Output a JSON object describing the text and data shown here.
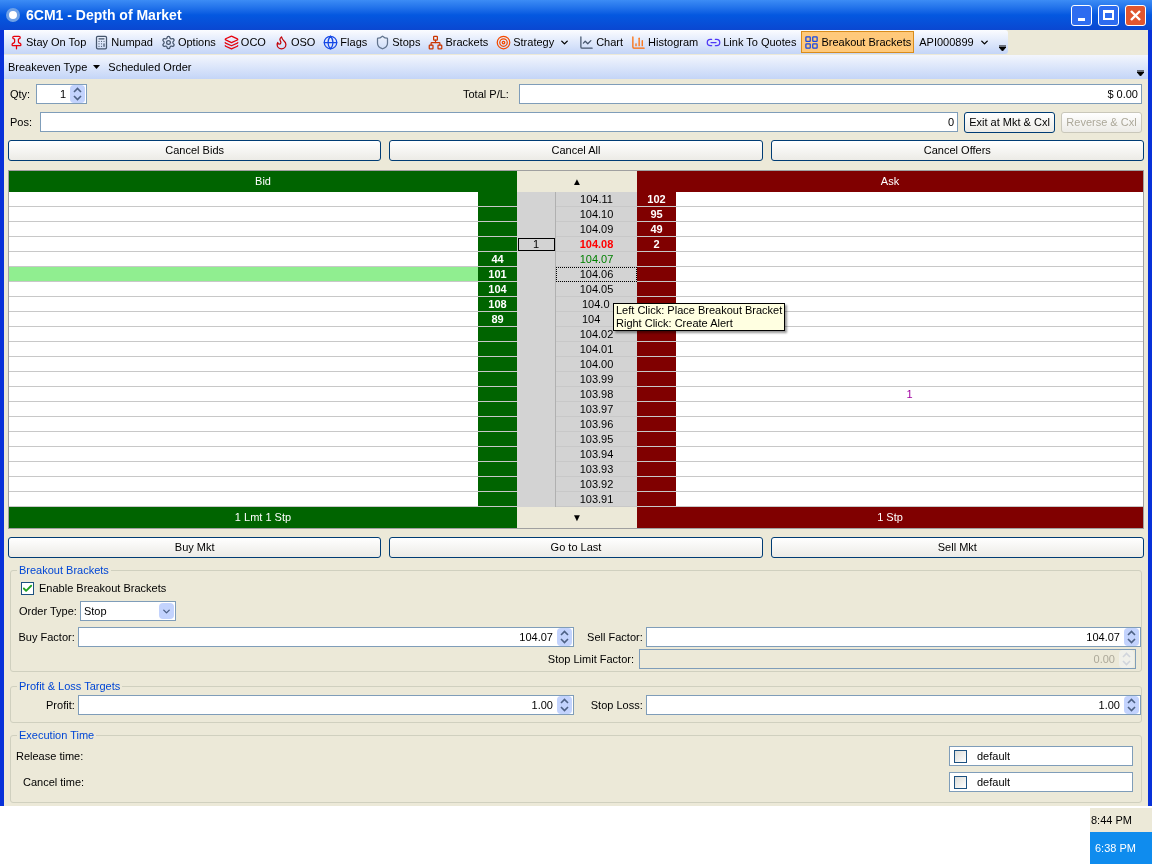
{
  "window": {
    "title": "6CM1 - Depth of Market"
  },
  "toolbar": [
    {
      "label": "Stay On Top",
      "kind": "button",
      "selected": false
    },
    {
      "label": "Numpad",
      "kind": "button",
      "selected": false
    },
    {
      "label": "Options",
      "kind": "button",
      "selected": false
    },
    {
      "label": "OCO",
      "kind": "button",
      "selected": false
    },
    {
      "label": "OSO",
      "kind": "button",
      "selected": false
    },
    {
      "label": "Flags",
      "kind": "button",
      "selected": false
    },
    {
      "label": "Stops",
      "kind": "button",
      "selected": false
    },
    {
      "label": "Brackets",
      "kind": "button",
      "selected": false
    },
    {
      "label": "Strategy",
      "kind": "dropdown",
      "selected": false
    },
    {
      "label": "Chart",
      "kind": "button",
      "selected": false
    },
    {
      "label": "Histogram",
      "kind": "button",
      "selected": false
    },
    {
      "label": "Link To Quotes",
      "kind": "button",
      "selected": false
    },
    {
      "label": "Breakout Brackets",
      "kind": "button",
      "selected": true
    },
    {
      "label": "API000899",
      "kind": "dropdown",
      "selected": false
    }
  ],
  "toolbar2": [
    {
      "label": "Breakeven Type",
      "kind": "dropdown"
    },
    {
      "label": "Scheduled Order",
      "kind": "button"
    }
  ],
  "qty": {
    "label": "Qty:",
    "value": "1"
  },
  "total_pl": {
    "label": "Total P/L:",
    "value": "$ 0.00"
  },
  "pos": {
    "label": "Pos:",
    "value": "0"
  },
  "pos_buttons": [
    {
      "label": "Exit at Mkt & Cxl",
      "disabled": false
    },
    {
      "label": "Reverse & Cxl",
      "disabled": true
    }
  ],
  "cancel_buttons": [
    "Cancel Bids",
    "Cancel All",
    "Cancel Offers"
  ],
  "ladder": {
    "header": {
      "bid": "Bid",
      "up": "▲",
      "ask": "Ask"
    },
    "rows": [
      {
        "price": "104.11",
        "kind": "normal",
        "bid": "",
        "order": "",
        "ask": "102",
        "ask_note": "",
        "selected": false,
        "focused": false
      },
      {
        "price": "104.10",
        "kind": "normal",
        "bid": "",
        "order": "",
        "ask": "95",
        "ask_note": "",
        "selected": false,
        "focused": false
      },
      {
        "price": "104.09",
        "kind": "normal",
        "bid": "",
        "order": "",
        "ask": "49",
        "ask_note": "",
        "selected": false,
        "focused": false
      },
      {
        "price": "104.08",
        "kind": "last",
        "bid": "",
        "order": "1",
        "ask": "2",
        "ask_note": "",
        "selected": false,
        "focused": false
      },
      {
        "price": "104.07",
        "kind": "up",
        "bid": "44",
        "order": "",
        "ask": "",
        "ask_note": "",
        "selected": false,
        "focused": false
      },
      {
        "price": "104.06",
        "kind": "normal",
        "bid": "101",
        "order": "",
        "ask": "",
        "ask_note": "",
        "selected": true,
        "focused": true
      },
      {
        "price": "104.05",
        "kind": "normal",
        "bid": "104",
        "order": "",
        "ask": "",
        "ask_note": "",
        "selected": false,
        "focused": false
      },
      {
        "price": "104.0",
        "kind": "normal",
        "bid": "108",
        "order": "",
        "ask": "",
        "ask_note": "",
        "selected": false,
        "focused": false
      },
      {
        "price": "104",
        "kind": "normal",
        "bid": "89",
        "order": "",
        "ask": "",
        "ask_note": "",
        "selected": false,
        "focused": false
      },
      {
        "price": "104.02",
        "kind": "normal",
        "bid": "",
        "order": "",
        "ask": "",
        "ask_note": "",
        "selected": false,
        "focused": false
      },
      {
        "price": "104.01",
        "kind": "normal",
        "bid": "",
        "order": "",
        "ask": "",
        "ask_note": "",
        "selected": false,
        "focused": false
      },
      {
        "price": "104.00",
        "kind": "normal",
        "bid": "",
        "order": "",
        "ask": "",
        "ask_note": "",
        "selected": false,
        "focused": false
      },
      {
        "price": "103.99",
        "kind": "normal",
        "bid": "",
        "order": "",
        "ask": "",
        "ask_note": "",
        "selected": false,
        "focused": false
      },
      {
        "price": "103.98",
        "kind": "normal",
        "bid": "",
        "order": "",
        "ask": "",
        "ask_note": "1",
        "selected": false,
        "focused": false
      },
      {
        "price": "103.97",
        "kind": "normal",
        "bid": "",
        "order": "",
        "ask": "",
        "ask_note": "",
        "selected": false,
        "focused": false
      },
      {
        "price": "103.96",
        "kind": "normal",
        "bid": "",
        "order": "",
        "ask": "",
        "ask_note": "",
        "selected": false,
        "focused": false
      },
      {
        "price": "103.95",
        "kind": "normal",
        "bid": "",
        "order": "",
        "ask": "",
        "ask_note": "",
        "selected": false,
        "focused": false
      },
      {
        "price": "103.94",
        "kind": "normal",
        "bid": "",
        "order": "",
        "ask": "",
        "ask_note": "",
        "selected": false,
        "focused": false
      },
      {
        "price": "103.93",
        "kind": "normal",
        "bid": "",
        "order": "",
        "ask": "",
        "ask_note": "",
        "selected": false,
        "focused": false
      },
      {
        "price": "103.92",
        "kind": "normal",
        "bid": "",
        "order": "",
        "ask": "",
        "ask_note": "",
        "selected": false,
        "focused": false
      },
      {
        "price": "103.91",
        "kind": "normal",
        "bid": "",
        "order": "",
        "ask": "",
        "ask_note": "",
        "selected": false,
        "focused": false
      }
    ],
    "footer": {
      "bid": "1 Lmt 1 Stp",
      "down": "▼",
      "ask": "1 Stp"
    },
    "tooltip": [
      "Left Click: Place Breakout Bracket",
      "Right Click: Create Alert"
    ]
  },
  "action_buttons": [
    "Buy Mkt",
    "Go to Last",
    "Sell Mkt"
  ],
  "breakout": {
    "title": "Breakout Brackets",
    "enable": {
      "label": "Enable Breakout Brackets",
      "checked": true
    },
    "order_type": {
      "label": "Order Type:",
      "value": "Stop"
    },
    "buy_factor": {
      "label": "Buy Factor:",
      "value": "104.07"
    },
    "sell_factor": {
      "label": "Sell Factor:",
      "value": "104.07"
    },
    "stop_limit": {
      "label": "Stop Limit Factor:",
      "value": "0.00",
      "disabled": true
    }
  },
  "pl_targets": {
    "title": "Profit & Loss Targets",
    "profit": {
      "label": "Profit:",
      "value": "1.00"
    },
    "stop_loss": {
      "label": "Stop Loss:",
      "value": "1.00"
    }
  },
  "execution": {
    "title": "Execution Time",
    "rows": [
      {
        "label": "Release time:",
        "checked": false,
        "value": "default"
      },
      {
        "label": "Cancel time:",
        "checked": false,
        "value": "default"
      }
    ]
  },
  "status": {
    "clock": "8:44 PM"
  },
  "taskbar": {
    "clock": "6:38 PM"
  }
}
